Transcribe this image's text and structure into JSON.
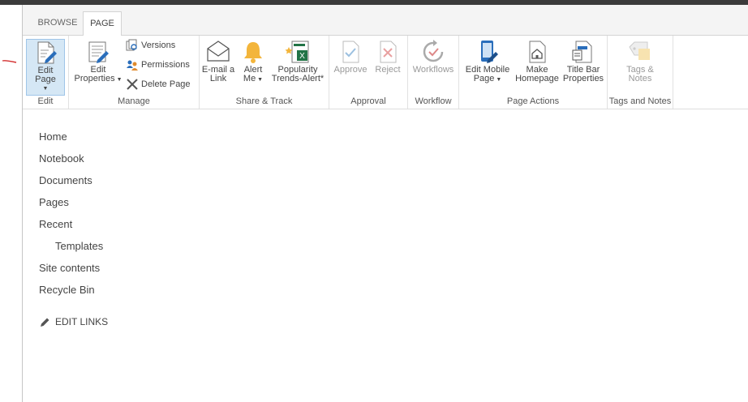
{
  "tabs": [
    {
      "label": "BROWSE"
    },
    {
      "label": "PAGE"
    }
  ],
  "ribbon": {
    "edit": {
      "group_label": "Edit",
      "edit_page_label": "Edit Page"
    },
    "manage": {
      "group_label": "Manage",
      "edit_properties_line1": "Edit",
      "edit_properties_line2": "Properties",
      "versions_label": "Versions",
      "permissions_label": "Permissions",
      "delete_page_label": "Delete Page"
    },
    "share_track": {
      "group_label": "Share & Track",
      "email_line1": "E-mail a",
      "email_line2": "Link",
      "alert_line1": "Alert",
      "alert_line2": "Me",
      "popularity_line1": "Popularity",
      "popularity_line2": "Trends-Alert*"
    },
    "approval": {
      "group_label": "Approval",
      "approve_label": "Approve",
      "reject_label": "Reject"
    },
    "workflow": {
      "group_label": "Workflow",
      "workflows_label": "Workflows"
    },
    "page_actions": {
      "group_label": "Page Actions",
      "edit_mobile_line1": "Edit Mobile",
      "edit_mobile_line2": "Page",
      "make_homepage_line1": "Make",
      "make_homepage_line2": "Homepage",
      "title_bar_line1": "Title Bar",
      "title_bar_line2": "Properties"
    },
    "tags_notes": {
      "group_label": "Tags and Notes",
      "tags_line1": "Tags &",
      "tags_line2": "Notes"
    }
  },
  "nav": {
    "items": [
      {
        "label": "Home"
      },
      {
        "label": "Notebook"
      },
      {
        "label": "Documents"
      },
      {
        "label": "Pages"
      },
      {
        "label": "Recent"
      },
      {
        "label": "Templates"
      },
      {
        "label": "Site contents"
      },
      {
        "label": "Recycle Bin"
      }
    ],
    "edit_links_label": "EDIT LINKS"
  },
  "icons": {
    "edit_page": "edit-page-icon",
    "edit_properties": "edit-properties-icon",
    "versions": "versions-icon",
    "permissions": "permissions-icon",
    "delete_page": "delete-icon",
    "email": "email-icon",
    "alert": "bell-icon",
    "popularity": "popularity-trends-icon",
    "approve": "approve-icon",
    "reject": "reject-icon",
    "workflows": "workflows-icon",
    "edit_mobile": "mobile-icon",
    "make_homepage": "homepage-icon",
    "title_bar": "title-bar-properties-icon",
    "tags": "tags-notes-icon",
    "edit_links": "pencil-icon"
  },
  "colors": {
    "top_bar": "#3b3b3b",
    "tab_bar": "#f4f4f4",
    "selected_button_bg": "#d5e7f5",
    "selected_button_border": "#9fc5e8",
    "accent_blue": "#2a6ebb",
    "alert_gold": "#f3b53b",
    "excel_green": "#217346",
    "annotation_red": "#d32f2f"
  }
}
